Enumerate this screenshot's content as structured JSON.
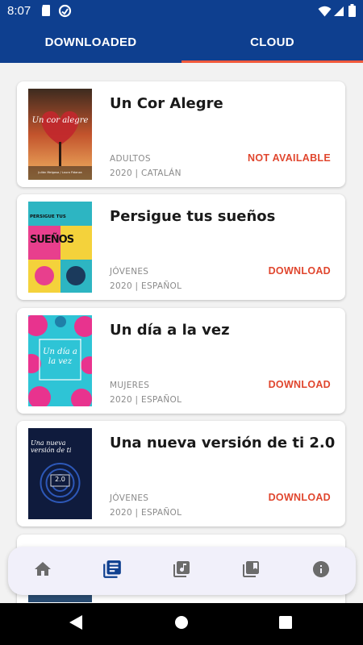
{
  "status_bar": {
    "time": "8:07"
  },
  "tabs": [
    {
      "label": "DOWNLOADED"
    },
    {
      "label": "CLOUD"
    }
  ],
  "books": [
    {
      "title": "Un Cor Alegre",
      "category": "ADULTOS",
      "meta": "2020 | CATALÁN",
      "action": "NOT AVAILABLE",
      "cover_text": "Un cor alegre",
      "cover_author": "Julián Melgosa / Laura Fidanza"
    },
    {
      "title": "Persigue tus sueños",
      "category": "JÓVENES",
      "meta": "2020 | ESPAÑOL",
      "action": "DOWNLOAD",
      "cover_text": "PERSIGUE TUS",
      "cover_big": "SUEÑOS"
    },
    {
      "title": "Un día a la vez",
      "category": "MUJERES",
      "meta": "2020 | ESPAÑOL",
      "action": "DOWNLOAD",
      "cover_text": "Un día a la vez"
    },
    {
      "title": "Una nueva versión de ti 2.0",
      "category": "JÓVENES",
      "meta": "2020 | ESPAÑOL",
      "action": "DOWNLOAD",
      "cover_text": "Una nueva versión de ti",
      "cover_sub": "2.0"
    }
  ],
  "bottom_nav": [
    {
      "icon": "home-icon"
    },
    {
      "icon": "library-books-icon",
      "active": true
    },
    {
      "icon": "music-library-icon"
    },
    {
      "icon": "collections-bookmark-icon"
    },
    {
      "icon": "info-icon"
    }
  ],
  "colors": {
    "primary": "#0e3f8f",
    "accent": "#e0462e",
    "nav_active": "#0e3f8f",
    "nav_inactive": "#6b6b6b"
  }
}
